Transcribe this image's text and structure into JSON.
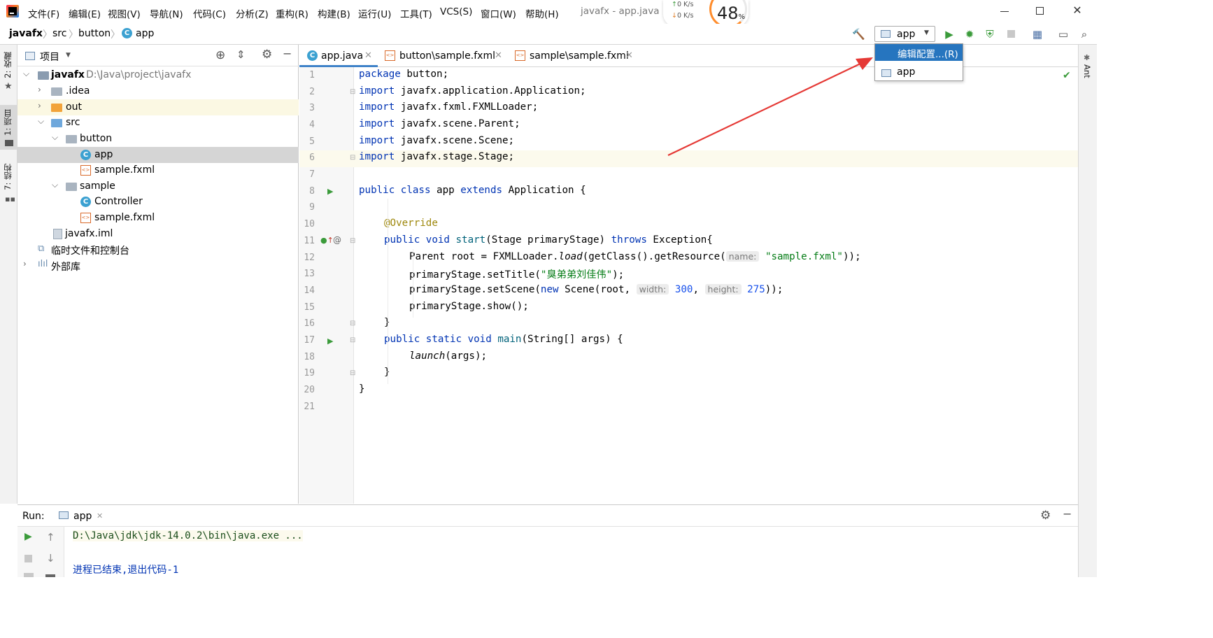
{
  "menu": [
    "文件(F)",
    "编辑(E)",
    "视图(V)",
    "导航(N)",
    "代码(C)",
    "分析(Z)",
    "重构(R)",
    "构建(B)",
    "运行(U)",
    "工具(T)",
    "VCS(S)",
    "窗口(W)",
    "帮助(H)"
  ],
  "window_title": "javafx - app.java",
  "net": {
    "up": "0  K/s",
    "down": "0  K/s",
    "load": "48",
    "load_unit": "%"
  },
  "breadcrumb": [
    "javafx",
    "src",
    "button",
    "app"
  ],
  "run_config": {
    "selected": "app",
    "menu_edit": "编辑配置...(R)",
    "menu_app": "app"
  },
  "left_tabs": {
    "favorites": "2: 收藏",
    "project": "1: 项目",
    "structure": "7: 结构"
  },
  "right_tabs": {
    "ant": "Ant"
  },
  "project_panel": {
    "title": "项目",
    "tree": [
      {
        "label": "javafx",
        "extra": "D:\\Java\\project\\javafx"
      },
      {
        "label": ".idea"
      },
      {
        "label": "out"
      },
      {
        "label": "src"
      },
      {
        "label": "button"
      },
      {
        "label": "app"
      },
      {
        "label": "sample.fxml"
      },
      {
        "label": "sample"
      },
      {
        "label": "Controller"
      },
      {
        "label": "sample.fxml"
      },
      {
        "label": "javafx.iml"
      },
      {
        "label": "临时文件和控制台"
      },
      {
        "label": "外部库"
      }
    ]
  },
  "tabs": [
    "app.java",
    "button\\sample.fxml",
    "sample\\sample.fxml"
  ],
  "line_numbers": [
    "1",
    "2",
    "3",
    "4",
    "5",
    "6",
    "7",
    "8",
    "9",
    "10",
    "11",
    "12",
    "13",
    "14",
    "15",
    "16",
    "17",
    "18",
    "19",
    "20",
    "21"
  ],
  "code": {
    "l1": {
      "kw": "package",
      "rest": " button;"
    },
    "l2": {
      "kw": "import",
      "rest": " javafx.application.Application;"
    },
    "l3": {
      "kw": "import",
      "rest": " javafx.fxml.FXMLLoader;"
    },
    "l4": {
      "kw": "import",
      "rest": " javafx.scene.Parent;"
    },
    "l5": {
      "kw": "import",
      "rest": " javafx.scene.Scene;"
    },
    "l6": {
      "kw": "import",
      "rest": " javafx.stage.Stage;"
    },
    "l8": {
      "kw1": "public",
      "kw2": "class",
      "name": " app ",
      "kw3": "extends",
      "rest": " Application {"
    },
    "l10": {
      "ann": "@Override"
    },
    "l11": {
      "kw1": "public",
      "kw2": "void",
      "method": "start",
      "mid": "(Stage primaryStage) ",
      "kw3": "throws",
      "rest": " Exception{"
    },
    "l12": {
      "a": "Parent root = FXMLLoader.",
      "it": "load",
      "b": "(getClass().getResource(",
      "hint": "name:",
      "str": "\"sample.fxml\"",
      "c": "));"
    },
    "l13": {
      "a": "primaryStage.setTitle(",
      "str": "\"臭弟弟刘佳伟\"",
      "c": ");"
    },
    "l14": {
      "a": "primaryStage.setScene(",
      "kw": "new",
      "b": " Scene(root, ",
      "hint1": "width:",
      "n1": "300",
      "sep": ", ",
      "hint2": "height:",
      "n2": "275",
      "c": "));"
    },
    "l15": {
      "a": "primaryStage.show();"
    },
    "l16": {
      "a": "}"
    },
    "l17": {
      "kw1": "public",
      "kw2": "static",
      "kw3": "void",
      "method": "main",
      "rest": "(String[] args) {"
    },
    "l18": {
      "it": "launch",
      "rest": "(args);"
    },
    "l19": {
      "a": "}"
    },
    "l20": {
      "a": "}"
    }
  },
  "run_panel": {
    "label": "Run:",
    "tab": "app",
    "output_cmd": "D:\\Java\\jdk\\jdk-14.0.2\\bin\\java.exe ...",
    "output_exit": "进程已结束,退出代码-1"
  },
  "colors": {
    "keyword": "#0033b3",
    "string": "#067d17",
    "number": "#1750eb",
    "annotation": "#9e880d",
    "selection": "#2675bf",
    "arrow": "#e53935"
  },
  "icons": [
    "intellij-logo-icon",
    "class-c-icon",
    "folder-icon",
    "fxml-file-icon",
    "hammer-build-icon",
    "run-play-icon",
    "debug-bug-icon",
    "coverage-icon",
    "stop-icon",
    "project-structure-icon",
    "terminal-icon",
    "search-icon",
    "locate-target-icon",
    "collapse-icon",
    "gear-icon",
    "minimize-icon",
    "checkmark-icon"
  ]
}
